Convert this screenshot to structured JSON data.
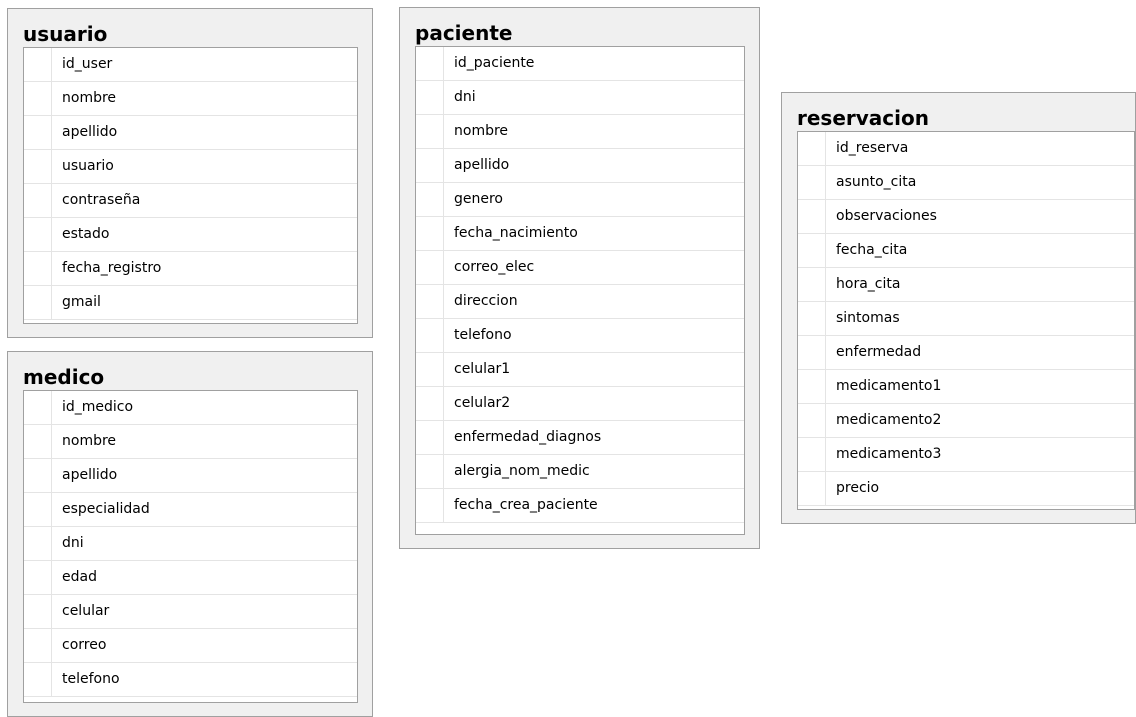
{
  "tables": {
    "usuario": {
      "title": "usuario",
      "columns": [
        "id_user",
        "nombre",
        "apellido",
        "usuario",
        "contraseña",
        "estado",
        "fecha_registro",
        "gmail"
      ]
    },
    "medico": {
      "title": "medico",
      "columns": [
        "id_medico",
        "nombre",
        "apellido",
        "especialidad",
        "dni",
        "edad",
        "celular",
        "correo",
        "telefono"
      ]
    },
    "paciente": {
      "title": "paciente",
      "columns": [
        "id_paciente",
        "dni",
        "nombre",
        "apellido",
        "genero",
        "fecha_nacimiento",
        "correo_elec",
        "direccion",
        "telefono",
        "celular1",
        "celular2",
        "enfermedad_diagnos",
        "alergia_nom_medic",
        "fecha_crea_paciente"
      ]
    },
    "reservacion": {
      "title": "reservacion",
      "columns": [
        "id_reserva",
        "asunto_cita",
        "observaciones",
        "fecha_cita",
        "hora_cita",
        "sintomas",
        "enfermedad",
        "medicamento1",
        "medicamento2",
        "medicamento3",
        "precio"
      ]
    }
  },
  "colors": {
    "box_background": "#f0f0f0",
    "box_border": "#a0a0a0",
    "grid_background": "#ffffff",
    "grid_line": "#e4e4e4",
    "text": "#000000"
  }
}
